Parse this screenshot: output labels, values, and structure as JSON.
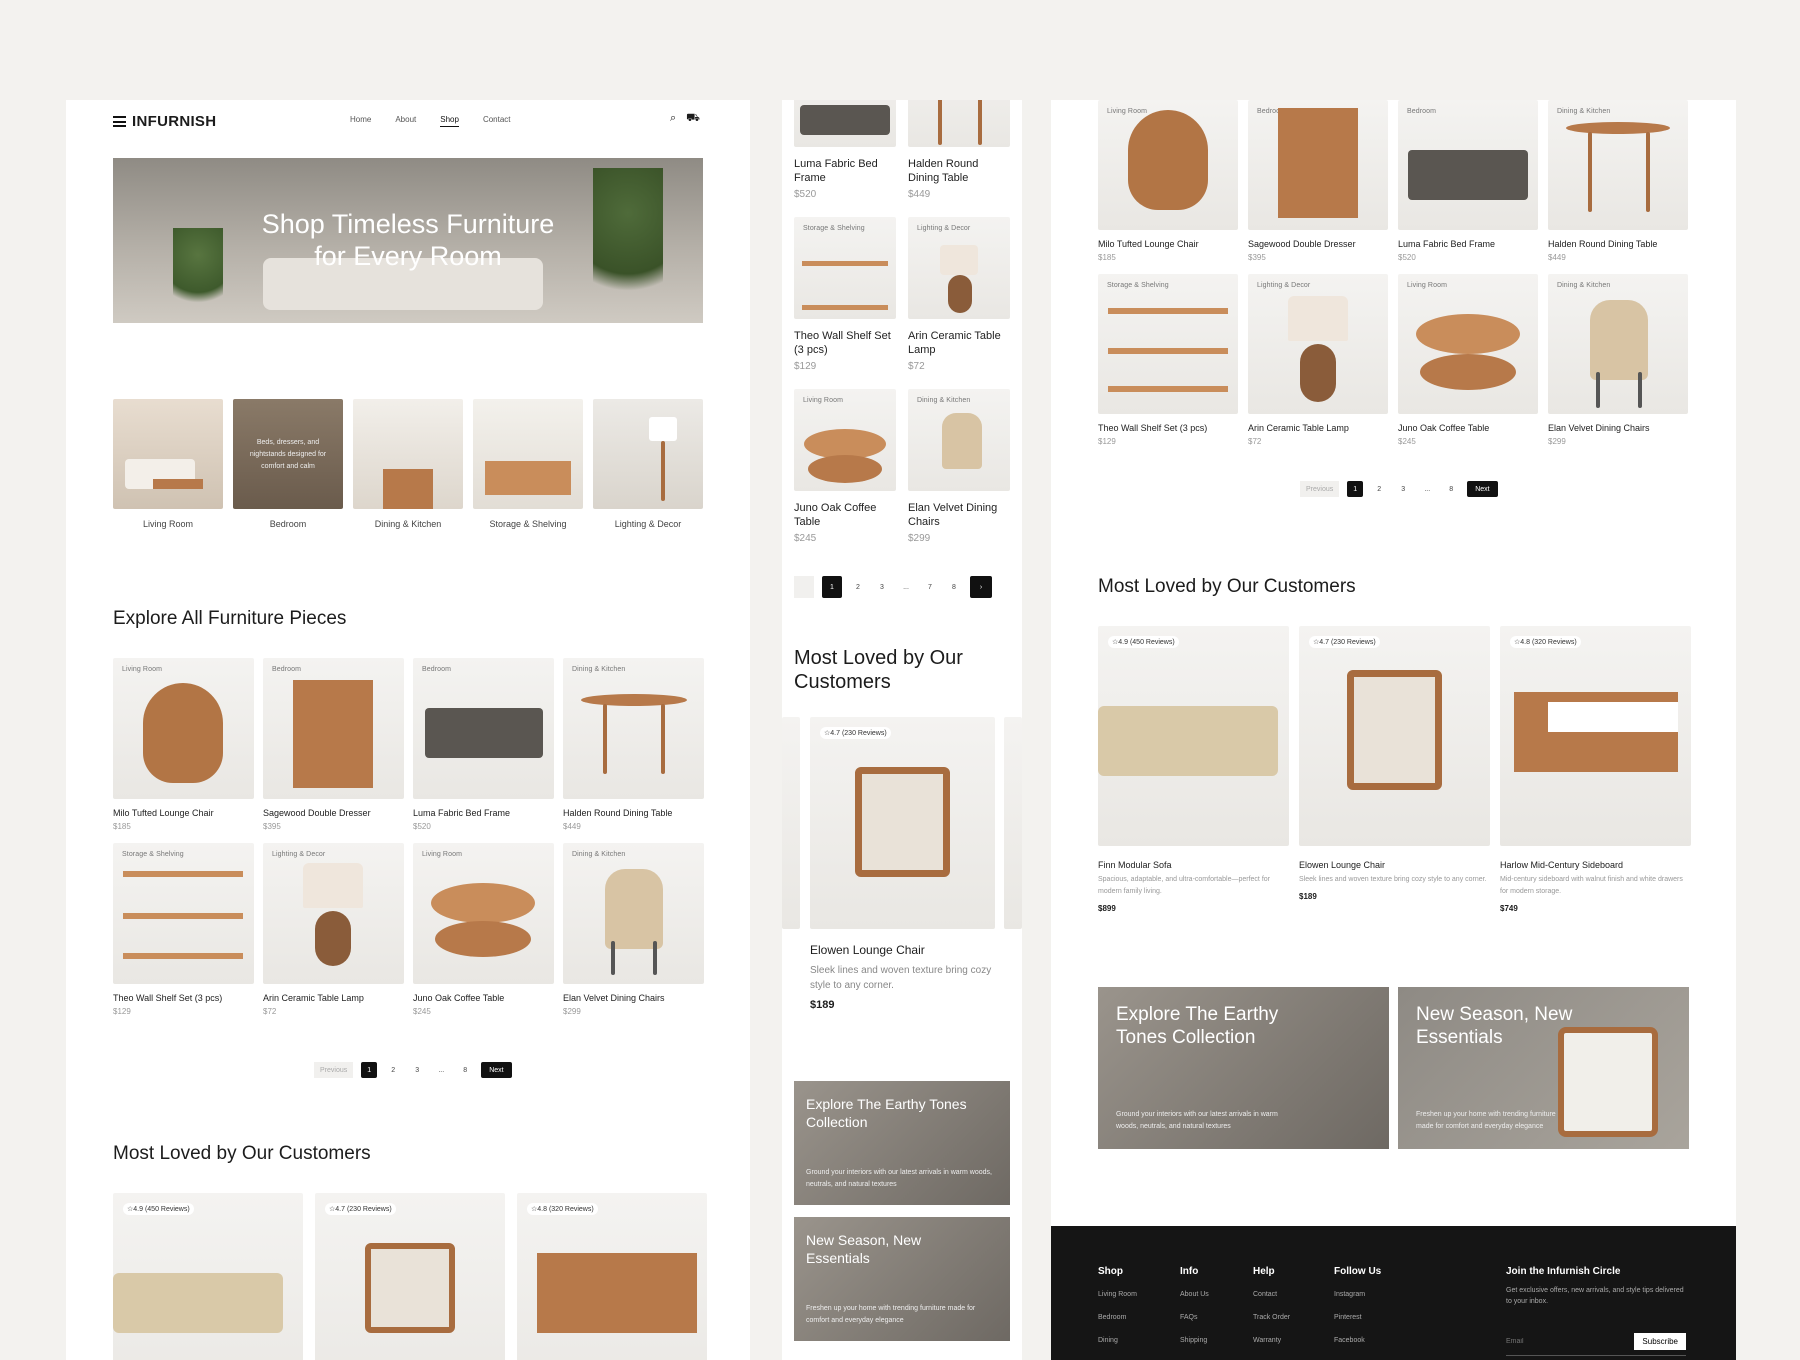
{
  "brand": "INFURNISH",
  "nav": {
    "home": "Home",
    "about": "About",
    "shop": "Shop",
    "contact": "Contact"
  },
  "hero": {
    "line1": "Shop Timeless Furniture",
    "line2": "for Every Room"
  },
  "categories": [
    {
      "label": "Living Room"
    },
    {
      "label": "Bedroom",
      "overlay": "Beds, dressers, and nightstands designed for comfort and calm"
    },
    {
      "label": "Dining & Kitchen"
    },
    {
      "label": "Storage & Shelving"
    },
    {
      "label": "Lighting & Decor"
    }
  ],
  "explore_title": "Explore All Furniture Pieces",
  "products": [
    {
      "tag": "Living Room",
      "name": "Milo Tufted Lounge Chair",
      "price": "$185"
    },
    {
      "tag": "Bedroom",
      "name": "Sagewood Double Dresser",
      "price": "$395"
    },
    {
      "tag": "Bedroom",
      "name": "Luma Fabric Bed Frame",
      "price": "$520"
    },
    {
      "tag": "Dining & Kitchen",
      "name": "Halden Round Dining Table",
      "price": "$449"
    },
    {
      "tag": "Storage & Shelving",
      "name": "Theo Wall Shelf Set (3 pcs)",
      "price": "$129"
    },
    {
      "tag": "Lighting & Decor",
      "name": "Arin Ceramic Table Lamp",
      "price": "$72"
    },
    {
      "tag": "Living Room",
      "name": "Juno Oak Coffee Table",
      "price": "$245"
    },
    {
      "tag": "Dining & Kitchen",
      "name": "Elan Velvet Dining Chairs",
      "price": "$299"
    }
  ],
  "pager": {
    "prev": "Previous",
    "pages": [
      "1",
      "2",
      "3",
      "...",
      "8"
    ],
    "next": "Next",
    "mobile_pages": [
      "1",
      "2",
      "3",
      "...",
      "7",
      "8"
    ]
  },
  "loved_title": "Most Loved by Our Customers",
  "loved": [
    {
      "rating": "☆4.9 (450 Reviews)",
      "name": "Finn Modular Sofa",
      "desc": "Spacious, adaptable, and ultra-comfortable—perfect for modern family living.",
      "price": "$899"
    },
    {
      "rating": "☆4.7 (230 Reviews)",
      "name": "Elowen Lounge Chair",
      "desc": "Sleek lines and woven texture bring cozy style to any corner.",
      "price": "$189"
    },
    {
      "rating": "☆4.8 (320 Reviews)",
      "name": "Harlow Mid-Century Sideboard",
      "desc": "Mid-century sideboard with walnut finish and white drawers for modern storage.",
      "price": "$749"
    }
  ],
  "banners": [
    {
      "title": "Explore The Earthy Tones Collection",
      "desc": "Ground your interiors with our latest arrivals in warm woods, neutrals, and natural textures"
    },
    {
      "title": "New Season, New Essentials",
      "desc": "Freshen up your home with trending furniture made for comfort and everyday elegance"
    }
  ],
  "footer": {
    "cols": [
      {
        "head": "Shop",
        "items": [
          "Living Room",
          "Bedroom",
          "Dining"
        ]
      },
      {
        "head": "Info",
        "items": [
          "About Us",
          "FAQs",
          "Shipping"
        ]
      },
      {
        "head": "Help",
        "items": [
          "Contact",
          "Track Order",
          "Warranty"
        ]
      },
      {
        "head": "Follow Us",
        "items": [
          "Instagram",
          "Pinterest",
          "Facebook"
        ]
      }
    ],
    "news_title": "Join the Infurnish Circle",
    "news_desc": "Get exclusive offers, new arrivals, and style tips delivered to your inbox.",
    "email_placeholder": "Email",
    "subscribe": "Subscribe"
  },
  "colors": {
    "wood": "#b7794a",
    "dark": "#151515",
    "accent": "#111111"
  }
}
